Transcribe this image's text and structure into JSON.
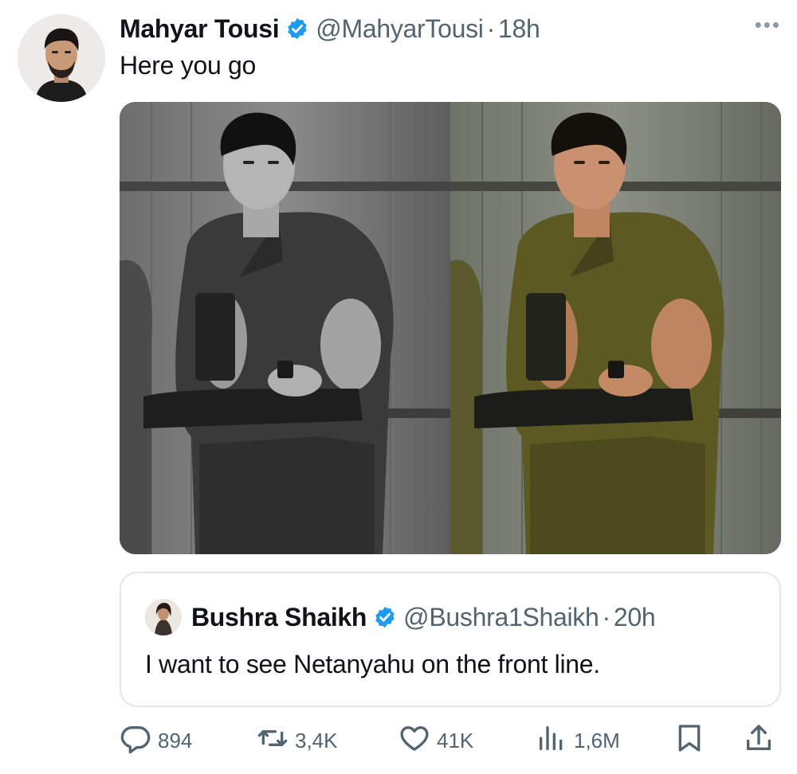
{
  "tweet": {
    "author_name": "Mahyar Tousi",
    "handle": "@MahyarTousi",
    "separator": "·",
    "time": "18h",
    "more_label": "•••",
    "text": "Here you go"
  },
  "quoted_tweet": {
    "author_name": "Bushra Shaikh",
    "handle": "@Bushra1Shaikh",
    "separator": "·",
    "time": "20h",
    "text": "I want to see Netanyahu on the front line."
  },
  "actions": {
    "replies": "894",
    "reposts": "3,4K",
    "likes": "41K",
    "views": "1,6M"
  },
  "icons": {
    "verified": "verified-badge-icon",
    "reply": "reply-icon",
    "repost": "repost-icon",
    "like": "heart-icon",
    "views": "views-icon",
    "bookmark": "bookmark-icon",
    "share": "share-icon"
  },
  "colors": {
    "verified_blue": "#1d9bf0",
    "text_primary": "#0f1419",
    "text_secondary": "#536471",
    "border": "#e3e7ea"
  }
}
